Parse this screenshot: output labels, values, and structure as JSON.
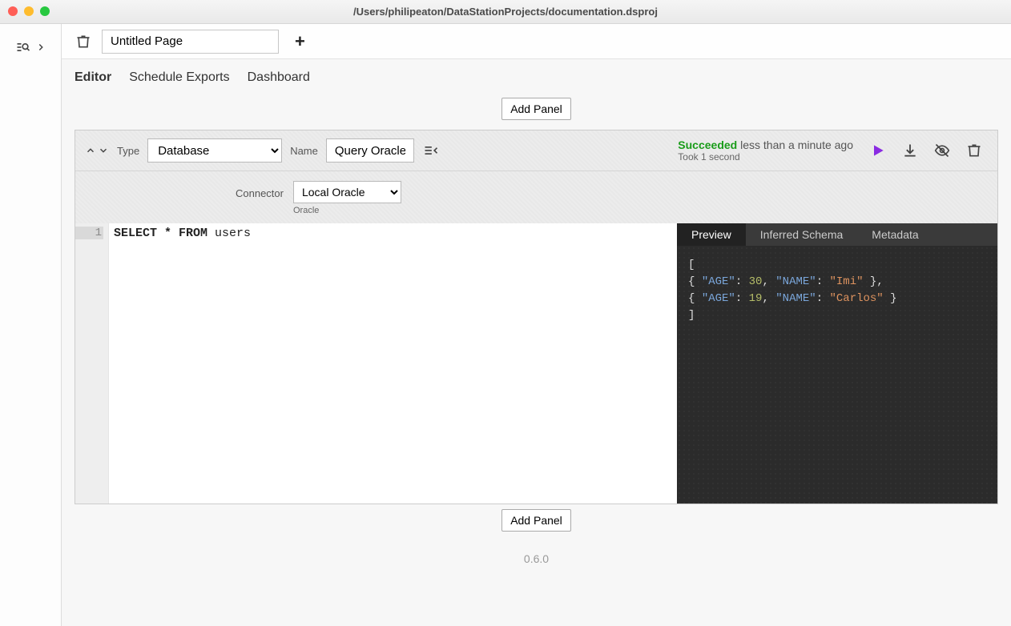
{
  "window": {
    "title": "/Users/philipeaton/DataStationProjects/documentation.dsproj"
  },
  "tabbar": {
    "page_title": "Untitled Page"
  },
  "subnav": {
    "editor": "Editor",
    "schedule_exports": "Schedule Exports",
    "dashboard": "Dashboard"
  },
  "buttons": {
    "add_panel": "Add Panel"
  },
  "panel": {
    "type_label": "Type",
    "type_value": "Database",
    "name_label": "Name",
    "name_value": "Query Oracle",
    "connector_label": "Connector",
    "connector_value": "Local Oracle",
    "connector_vendor": "Oracle",
    "status": {
      "state": "Succeeded",
      "relative": "less than a minute ago",
      "duration": "Took 1 second"
    },
    "code": {
      "line1_keywords": "SELECT * FROM ",
      "line1_ident": "users",
      "line_number": "1"
    },
    "result_tabs": {
      "preview": "Preview",
      "inferred_schema": "Inferred Schema",
      "metadata": "Metadata"
    },
    "result_data": [
      {
        "AGE": 30,
        "NAME": "Imi"
      },
      {
        "AGE": 19,
        "NAME": "Carlos"
      }
    ]
  },
  "footer": {
    "version": "0.6.0"
  }
}
